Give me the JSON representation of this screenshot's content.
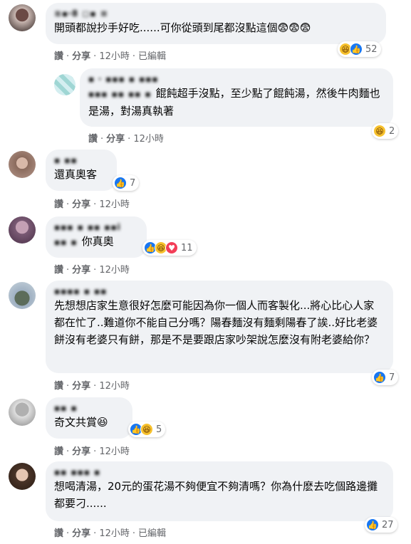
{
  "labels": {
    "like": "讚",
    "reply": "分享",
    "edited": "已編輯"
  },
  "comments": [
    {
      "name": "≋▪ꞏ8 ◻▪ ≡",
      "text": "開頭都說抄手好吃......可你從頭到尾都沒點這個😨😨😨",
      "time": "12小時",
      "edited": true,
      "count": "52",
      "reactions": [
        "haha",
        "like"
      ]
    },
    {
      "name": "▪ ꞏ ▪▪▪ ▪ ▪▪▪",
      "inline_name": "▪▪▪ ▪▪ ▪▪ ▪",
      "text": "餛飩超手沒點，至少點了餛飩湯，然後牛肉麵也是湯，對湯真執著",
      "time": "12小時",
      "count": "2",
      "reactions": [
        "haha"
      ]
    },
    {
      "name": "▪ ▪▪",
      "text": "還真奧客",
      "time": "12小時",
      "count": "7",
      "reactions": [
        "like"
      ]
    },
    {
      "name": "▪▪▪ ▪ ▪▪ ▪▪i",
      "inline_name": "▪▪ ▪",
      "text": "你真奧",
      "time": "12小時",
      "count": "11",
      "reactions": [
        "like",
        "haha",
        "love"
      ]
    },
    {
      "name": "▪▪▪▪ ▪ ▪▪",
      "text": "先想想店家生意很好怎麼可能因為你一個人而客製化...將心比心人家都在忙了..難道你不能自己分嗎？陽春麵沒有麵剩陽春了誒..好比老婆餅沒有老婆只有餅，那是不是要跟店家吵架說怎麼沒有附老婆給你？",
      "time": "12小時",
      "count": "7",
      "reactions": [
        "like"
      ]
    },
    {
      "name": "▪▪ ▪",
      "text": "奇文共賞😆",
      "time": "12小時",
      "count": "5",
      "reactions": [
        "like",
        "haha"
      ]
    },
    {
      "name": "▪▪ ▪▪▪ ▪",
      "text": "想喝清湯，20元的蛋花湯不夠便宜不夠清嗎？你為什麽去吃個路邊攤都要刁......",
      "time": "12小時",
      "edited": true,
      "count": "27",
      "reactions": [
        "like"
      ]
    }
  ]
}
